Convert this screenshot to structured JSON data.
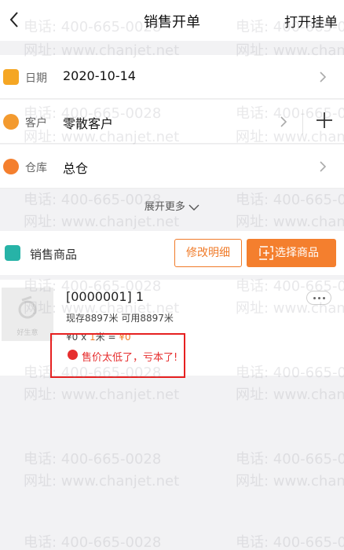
{
  "header": {
    "title": "销售开单",
    "right_action": "打开挂单"
  },
  "form": {
    "date": {
      "label": "日期",
      "value": "2020-10-14"
    },
    "customer": {
      "label": "客户",
      "value": "零散客户"
    },
    "warehouse": {
      "label": "仓库",
      "value": "总仓"
    }
  },
  "expand_label": "展开更多",
  "goods": {
    "label": "销售商品",
    "modify_button": "修改明细",
    "select_button": "选择商品"
  },
  "product": {
    "thumb_text": "好生意",
    "name": "[0000001] 1",
    "stock": "现存8897米  可用8897米",
    "price_prefix": "¥0 x ",
    "qty": "1",
    "unit_eq": "米 = ",
    "total": "¥0",
    "warning": "售价太低了，亏本了!"
  },
  "watermark": {
    "phone": "电话: 400-665-0028",
    "site": "网址: www.chanjet.net"
  },
  "colors": {
    "accent": "#f47f2e",
    "warning": "#e62e2e",
    "goods_icon": "#27b3a7"
  }
}
